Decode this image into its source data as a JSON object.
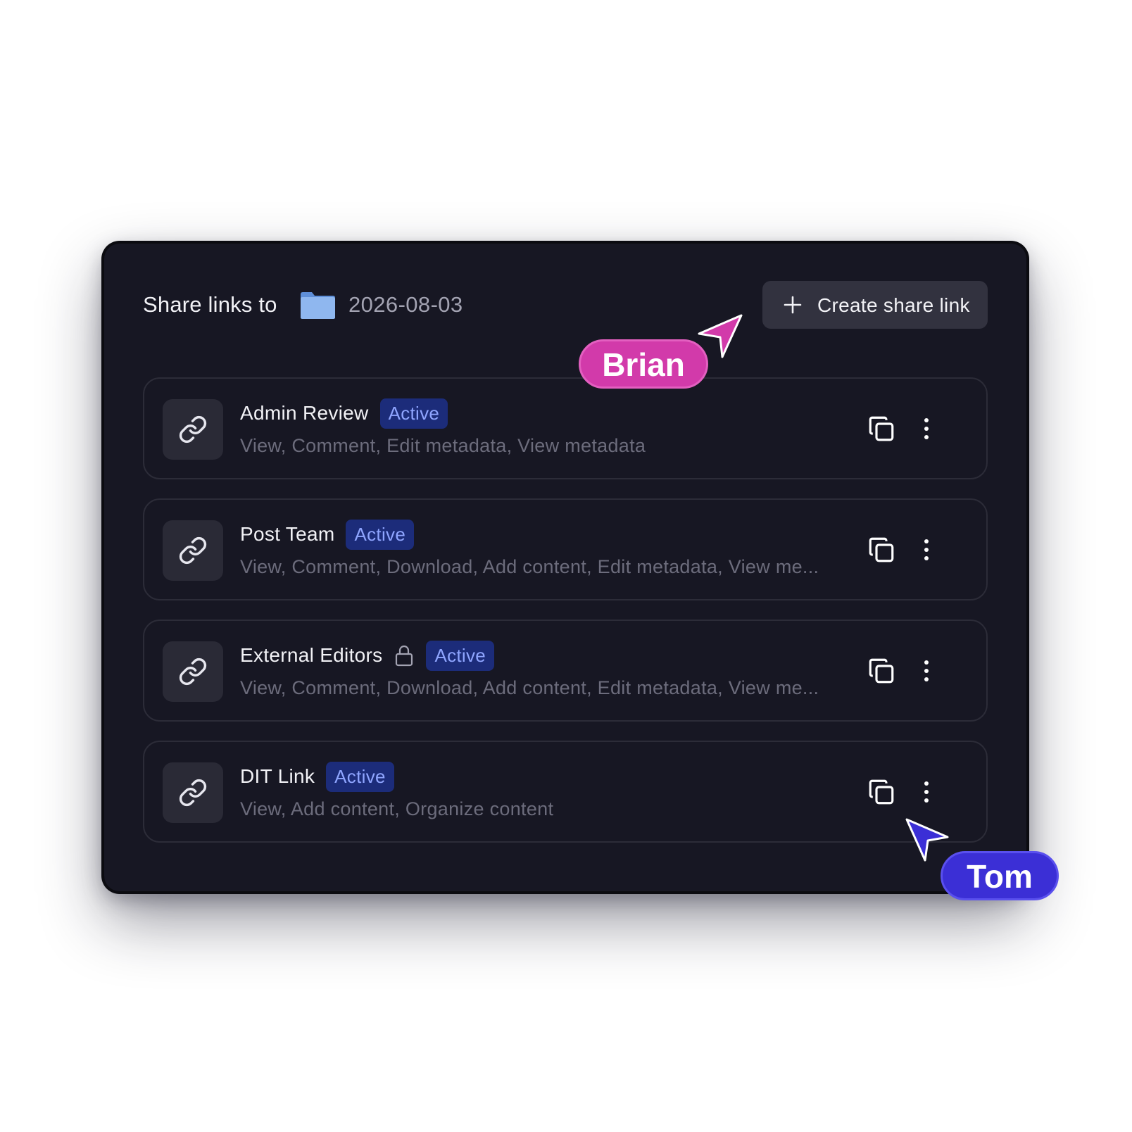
{
  "header": {
    "title": "Share links to",
    "folder_name": "2026-08-03",
    "create_button_label": "Create share link"
  },
  "links": [
    {
      "name": "Admin Review",
      "status": "Active",
      "locked": false,
      "permissions": "View, Comment, Edit metadata, View metadata"
    },
    {
      "name": "Post Team",
      "status": "Active",
      "locked": false,
      "permissions": "View, Comment, Download, Add content, Edit metadata, View me..."
    },
    {
      "name": "External Editors",
      "status": "Active",
      "locked": true,
      "permissions": "View, Comment, Download, Add content, Edit metadata, View me..."
    },
    {
      "name": "DIT Link",
      "status": "Active",
      "locked": false,
      "permissions": "View, Add content, Organize content"
    }
  ],
  "collaborators": [
    {
      "name": "Brian",
      "color": "#d23aaa"
    },
    {
      "name": "Tom",
      "color": "#3b2fd6"
    }
  ],
  "colors": {
    "panel_bg": "#171723",
    "badge_bg": "#1c2c7a",
    "badge_text": "#8fa5ff",
    "folder": "#8fb7ef"
  },
  "icons": {
    "item_icon": "link-icon",
    "copy": "copy-icon",
    "more": "more-vertical-icon",
    "lock": "lock-icon",
    "folder": "folder-icon",
    "create": "plus-icon"
  }
}
